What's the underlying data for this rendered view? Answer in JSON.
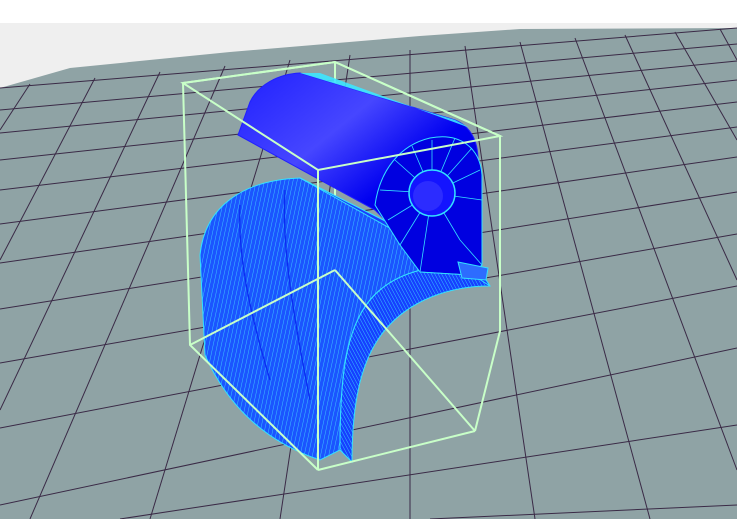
{
  "viewport": {
    "label": "",
    "colors": {
      "background_top": "#ffffff",
      "sky": "#efefef",
      "floor": "#8fa3a5",
      "grid_line": "#3a2a46",
      "bounding_box": "#c8ffc8",
      "mesh_body": "#0000ff",
      "mesh_shade": "#0a0ad8",
      "mesh_edge": "#33e0ff"
    },
    "icons": [
      "bounding-box-icon",
      "mesh-part-icon"
    ],
    "scene": {
      "objects": [
        {
          "name": "cylinder-part",
          "kind": "cylinder"
        },
        {
          "name": "curved-arch-part",
          "kind": "arch"
        }
      ]
    }
  }
}
